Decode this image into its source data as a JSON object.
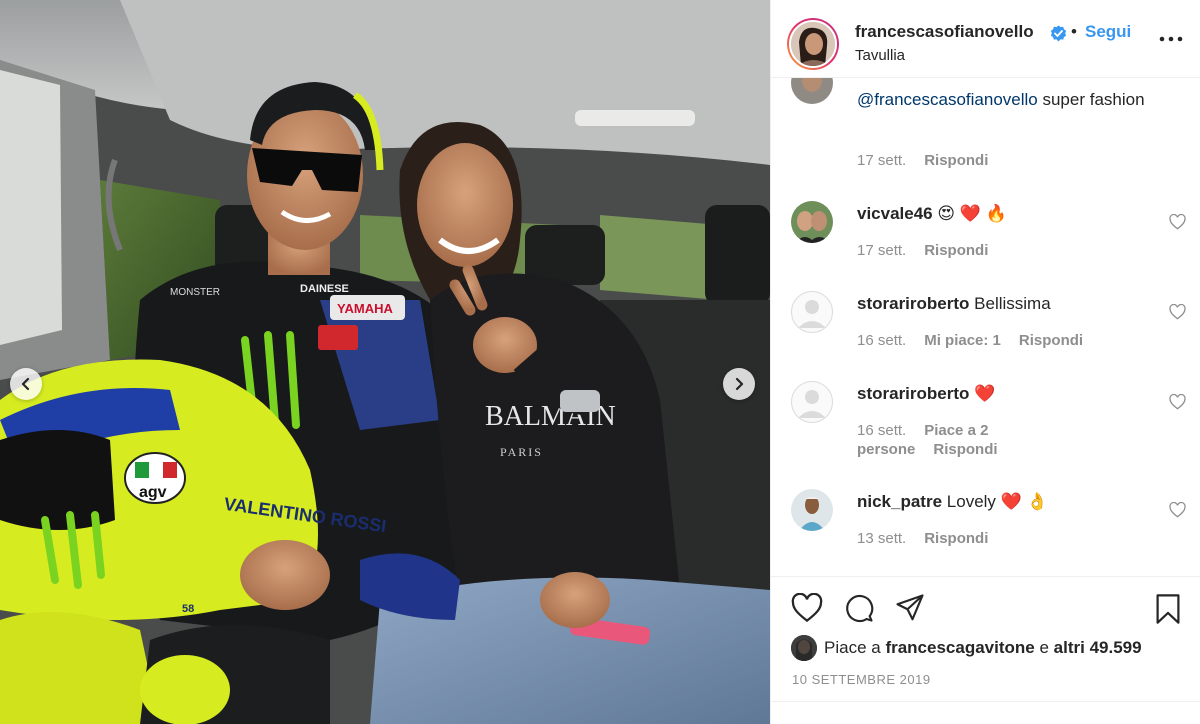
{
  "header": {
    "username": "francescasofianovello",
    "separator": "•",
    "follow_label": "Segui",
    "location": "Tavullia"
  },
  "comments": [
    {
      "mention": "@francescasofianovello",
      "text": " super fashion",
      "time": "17 sett.",
      "reply": "Rispondi"
    },
    {
      "username": "vicvale46",
      "text": "😍 ❤️ 🔥",
      "time": "17 sett.",
      "reply": "Rispondi"
    },
    {
      "username": "storariroberto",
      "text": "Bellissima",
      "time": "16 sett.",
      "likes": "Mi piace: 1",
      "reply": "Rispondi"
    },
    {
      "username": "storariroberto",
      "text": "❤️",
      "time": "16 sett.",
      "likes": "Piace a 2 persone",
      "reply": "Rispondi"
    },
    {
      "username": "nick_patre",
      "text": "Lovely ❤️ 👌",
      "time": "13 sett.",
      "reply": "Rispondi"
    }
  ],
  "likes": {
    "prefix": "Piace a",
    "user": "francescagavitone",
    "conj": "e",
    "others": "altri 49.599"
  },
  "date": "10 SETTEMBRE 2019",
  "photo": {
    "helmet_brand": "agv",
    "helmet_text": "VALENTINO ROSSI",
    "sponsor_1": "YAMAHA",
    "sponsor_2": "MONSTER",
    "sponsor_3": "DAINESE",
    "shirt_text": "BALMAIN",
    "shirt_sub": "PARIS",
    "helmet_number": "58"
  },
  "icons": {
    "verified": "verified-badge-icon",
    "more": "more-options-icon",
    "heart": "heart-icon",
    "comment": "comment-icon",
    "share": "share-icon",
    "save": "bookmark-icon",
    "prev": "chevron-left-icon",
    "next": "chevron-right-icon"
  },
  "colors": {
    "link": "#3897f0",
    "mention": "#00376b",
    "muted": "#8e8e8e",
    "text": "#262626",
    "helmet_yellow": "#d6ec20"
  }
}
